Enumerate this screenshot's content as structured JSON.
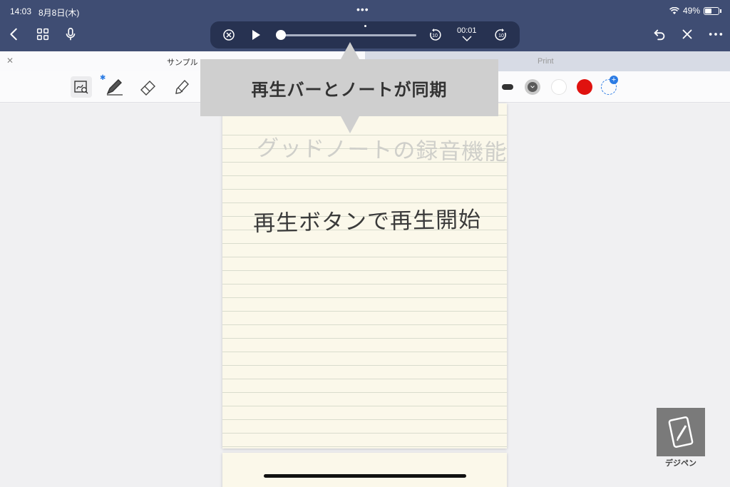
{
  "status_bar": {
    "time": "14:03",
    "date": "8月8日(木)",
    "battery": "49%"
  },
  "player": {
    "time": "00:01",
    "skip_back": "10",
    "skip_forward": "10",
    "progress": 0.0
  },
  "tabs": [
    {
      "title": "サンプル",
      "active": true
    },
    {
      "title": "Print",
      "active": false
    }
  ],
  "toolbar": {
    "colors": {
      "dark": "#5b5b5b",
      "white": "#ffffff",
      "red": "#e0120f",
      "accent": "#2b7be4"
    }
  },
  "callout": {
    "text": "再生バーとノートが同期"
  },
  "note": {
    "faint_heading": "グッドノートの録音機能",
    "main_text": "再生ボタンで再生開始"
  },
  "watermark": {
    "label": "デジペン"
  },
  "icons": [
    "chevron-left-icon",
    "grid-icon",
    "microphone-icon",
    "close-circle-icon",
    "play-icon",
    "skip-back-icon",
    "skip-forward-icon",
    "chevron-down-icon",
    "undo-icon",
    "close-icon",
    "more-icon",
    "lasso-zoom-icon",
    "pen-icon",
    "eraser-icon",
    "highlighter-icon",
    "add-color-icon"
  ]
}
